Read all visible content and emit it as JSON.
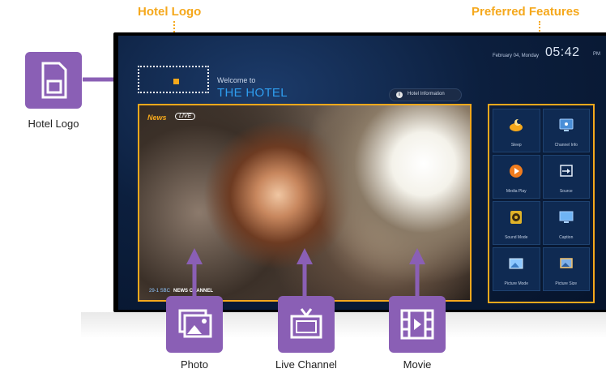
{
  "callouts": {
    "hotel_logo_top": "Hotel Logo",
    "preferred_features": "Preferred Features",
    "hotel_logo_side": "Hotel Logo",
    "photo": "Photo",
    "live_channel": "Live Channel",
    "movie": "Movie"
  },
  "screen": {
    "date": "February 04, Monday",
    "time": "05:42",
    "ampm": "PM",
    "welcome": "Welcome to",
    "hotel_name": "THE HOTEL",
    "hotel_info_button": "Hotel Information",
    "news_label": "News",
    "live_label": "LIVE",
    "channel_number": "29-1 SBC",
    "channel_program": "NEWS CHANNEL"
  },
  "features": [
    {
      "label": "Sleep",
      "icon": "sleep-moon-icon"
    },
    {
      "label": "Channel Info",
      "icon": "channel-info-icon"
    },
    {
      "label": "Media Play",
      "icon": "media-play-icon"
    },
    {
      "label": "Source",
      "icon": "source-icon"
    },
    {
      "label": "Sound Mode",
      "icon": "speaker-icon"
    },
    {
      "label": "Caption",
      "icon": "caption-icon"
    },
    {
      "label": "Picture Mode",
      "icon": "picture-mode-icon"
    },
    {
      "label": "Picture Size",
      "icon": "picture-size-icon"
    }
  ],
  "colors": {
    "accent": "#f5a81c",
    "callout_purple": "#8a5fb5",
    "screen_bg": "#0c1f3e",
    "hotel_name": "#2f9ef0"
  }
}
